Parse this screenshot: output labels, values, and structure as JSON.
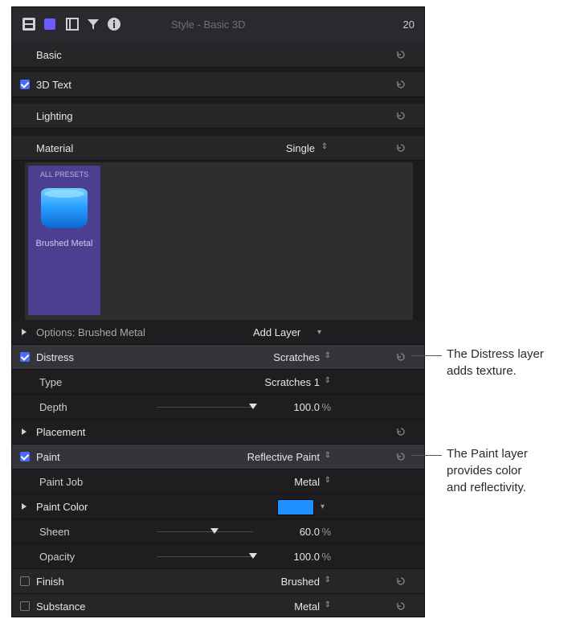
{
  "header": {
    "title": "Style - Basic 3D",
    "value": "20"
  },
  "rows": {
    "basic": "Basic",
    "text3d": "3D Text",
    "lighting": "Lighting",
    "material": "Material",
    "material_value": "Single",
    "options": "Options: Brushed Metal",
    "add_layer": "Add Layer",
    "distress": "Distress",
    "distress_value": "Scratches",
    "type": "Type",
    "type_value": "Scratches 1",
    "depth": "Depth",
    "depth_value": "100.0",
    "depth_level": 1.0,
    "placement": "Placement",
    "paint": "Paint",
    "paint_value": "Reflective Paint",
    "paint_job": "Paint Job",
    "paint_job_value": "Metal",
    "paint_color": "Paint Color",
    "paint_color_hex": "#1e90ff",
    "sheen": "Sheen",
    "sheen_value": "60.0",
    "sheen_level": 0.6,
    "opacity": "Opacity",
    "opacity_value": "100.0",
    "opacity_level": 1.0,
    "finish": "Finish",
    "finish_value": "Brushed",
    "substance": "Substance",
    "substance_value": "Metal",
    "percent": "%"
  },
  "swatch": {
    "caption": "ALL PRESETS",
    "name": "Brushed Metal"
  },
  "annotations": {
    "distress": [
      "The Distress layer",
      "adds texture."
    ],
    "paint": [
      "The Paint layer",
      "provides color",
      "and reflectivity."
    ]
  },
  "colors": {
    "accent": "#4b6bff",
    "panel": "#1c1c1e",
    "swatch_bg": "#4a3f91"
  }
}
